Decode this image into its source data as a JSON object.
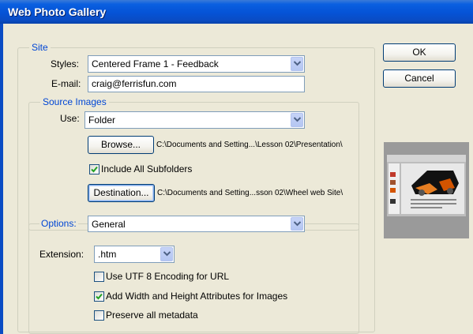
{
  "window": {
    "title": "Web Photo Gallery"
  },
  "site": {
    "legend": "Site",
    "styles_label": "Styles:",
    "styles_value": "Centered Frame 1 - Feedback",
    "email_label": "E-mail:",
    "email_value": "craig@ferrisfun.com"
  },
  "source": {
    "legend": "Source Images",
    "use_label": "Use:",
    "use_value": "Folder",
    "browse_label": "Browse...",
    "browse_path": "C:\\Documents and Setting...\\Lesson 02\\Presentation\\",
    "include_subfolders_label": "Include All Subfolders",
    "include_subfolders_checked": true,
    "destination_label": "Destination...",
    "destination_path": "C:\\Documents and Setting...sson 02\\Wheel web Site\\"
  },
  "options": {
    "label": "Options:",
    "value": "General",
    "extension_label": "Extension:",
    "extension_value": ".htm",
    "utf8_label": "Use UTF 8 Encoding for URL",
    "utf8_checked": false,
    "width_height_label": "Add Width and Height Attributes for Images",
    "width_height_checked": true,
    "metadata_label": "Preserve all metadata",
    "metadata_checked": false
  },
  "buttons": {
    "ok": "OK",
    "cancel": "Cancel"
  },
  "colors": {
    "titlebar": "#0553d6",
    "legend_text": "#0046d5",
    "dialog_bg": "#ece9d8"
  },
  "icons": {
    "dropdown": "chevron-down-icon",
    "check": "checkmark-icon",
    "preview": "gallery-preview-thumbnail"
  }
}
